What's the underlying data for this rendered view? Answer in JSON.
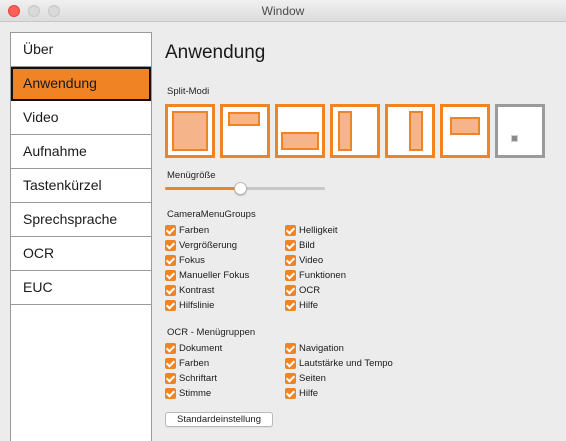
{
  "window": {
    "title": "Window"
  },
  "sidebar": {
    "items": [
      {
        "label": "Über"
      },
      {
        "label": "Anwendung",
        "active": true
      },
      {
        "label": "Video"
      },
      {
        "label": "Aufnahme"
      },
      {
        "label": "Tastenkürzel"
      },
      {
        "label": "Sprechsprache"
      },
      {
        "label": "OCR"
      },
      {
        "label": "EUC"
      }
    ]
  },
  "main": {
    "title": "Anwendung",
    "split_section_label": "Split-Modi",
    "menu_size_label": "Menügröße",
    "menu_size_value": 0.47,
    "camera_groups_label": "CameraMenuGroups",
    "camera_left": [
      "Farben",
      "Vergrößerung",
      "Fokus",
      "Manueller Fokus",
      "Kontrast",
      "Hilfslinie"
    ],
    "camera_right": [
      "Helligkeit",
      "Bild",
      "Video",
      "Funktionen",
      "OCR",
      "Hilfe"
    ],
    "ocr_groups_label": "OCR - Menügruppen",
    "ocr_left": [
      "Dokument",
      "Farben",
      "Schriftart",
      "Stimme"
    ],
    "ocr_right": [
      "Navigation",
      "Lautstärke und Tempo",
      "Seiten",
      "Hilfe"
    ],
    "reset_label": "Standardeinstellung"
  },
  "colors": {
    "accent": "#f08424",
    "pane_fill": "#f6b48a",
    "close_button": "#ff5f57",
    "inactive_border": "#9a9a9a"
  }
}
